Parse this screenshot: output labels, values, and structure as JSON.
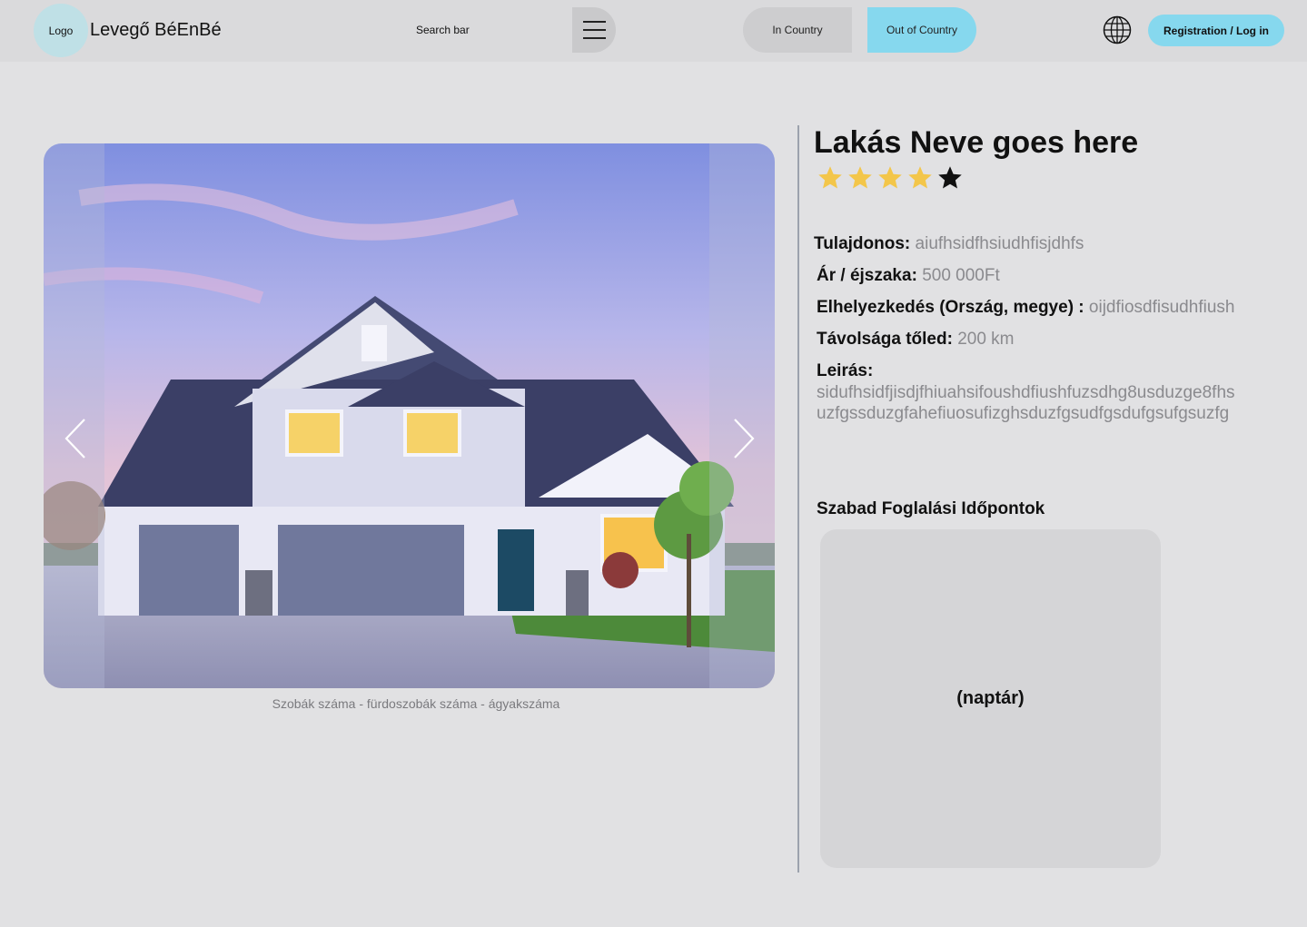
{
  "header": {
    "logo_label": "Logo",
    "brand_name": "Levegő BéEnBé",
    "search_label": "Search bar",
    "tab_in_country": "In Country",
    "tab_out_country": "Out of Country",
    "auth_label": "Registration / Log in",
    "active_tab_color": "#86d8ee"
  },
  "gallery": {
    "caption": "Szobák száma - fürdoszobák száma - ágyakszáma",
    "prev_icon": "chevron-left-icon",
    "next_icon": "chevron-right-icon"
  },
  "listing": {
    "title": "Lakás Neve goes here",
    "rating": 4,
    "rating_max": 5,
    "owner_label": "Tulajdonos:",
    "owner_value": "aiufhsidfhsiudhfisjdhfs",
    "price_label": "Ár / éjszaka:",
    "price_value": "500 000Ft",
    "location_label": "Elhelyezkedés (Ország, megye) :",
    "location_value": "oijdfiosdfisudhfiush",
    "distance_label": "Távolsága tőled:",
    "distance_value": "200 km",
    "description_label": "Leirás:",
    "description_value": "sidufhsidfjisdjfhiuahsifoushdfiushfuzsdhg8usduzge8fhsuzfgssduzgfahefiuosufizghsduzfgsudfgsdufgsufgsuzfg"
  },
  "booking": {
    "title": "Szabad Foglalási Időpontok",
    "calendar_placeholder": "(naptár)"
  }
}
